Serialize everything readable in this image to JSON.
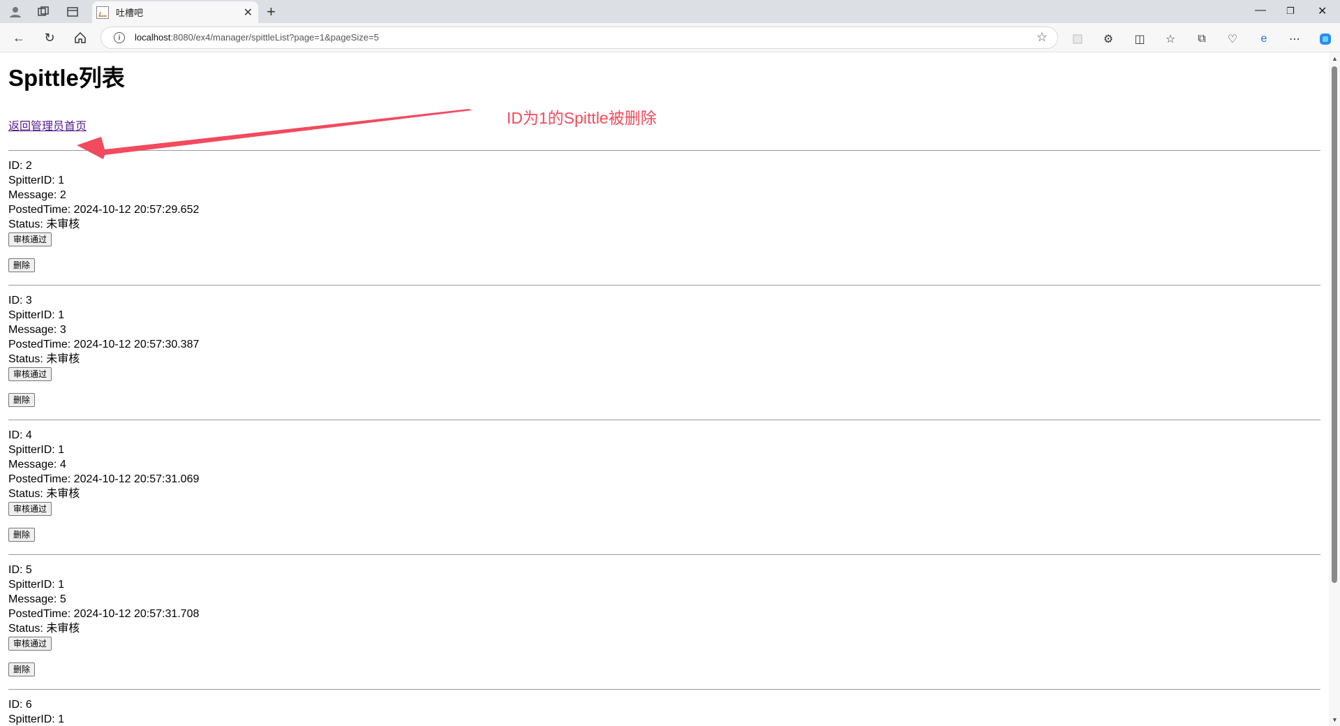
{
  "browser": {
    "tab_title": "吐槽吧",
    "url_host": "localhost",
    "url_rest": ":8080/ex4/manager/spittleList?page=1&pageSize=5"
  },
  "page": {
    "title": "Spittle列表",
    "back_link": "返回管理员首页",
    "approve_label": "审核通过",
    "delete_label": "删除"
  },
  "annotation": {
    "text": "ID为1的Spittle被删除",
    "color": "#f24a5e"
  },
  "entries": [
    {
      "id": "ID: 2",
      "spitter": "SpitterID: 1",
      "message": "Message: 2",
      "posted": "PostedTime: 2024-10-12 20:57:29.652",
      "status": "Status: 未审核"
    },
    {
      "id": "ID: 3",
      "spitter": "SpitterID: 1",
      "message": "Message: 3",
      "posted": "PostedTime: 2024-10-12 20:57:30.387",
      "status": "Status: 未审核"
    },
    {
      "id": "ID: 4",
      "spitter": "SpitterID: 1",
      "message": "Message: 4",
      "posted": "PostedTime: 2024-10-12 20:57:31.069",
      "status": "Status: 未审核"
    },
    {
      "id": "ID: 5",
      "spitter": "SpitterID: 1",
      "message": "Message: 5",
      "posted": "PostedTime: 2024-10-12 20:57:31.708",
      "status": "Status: 未审核"
    },
    {
      "id": "ID: 6",
      "spitter": "SpitterID: 1"
    }
  ]
}
